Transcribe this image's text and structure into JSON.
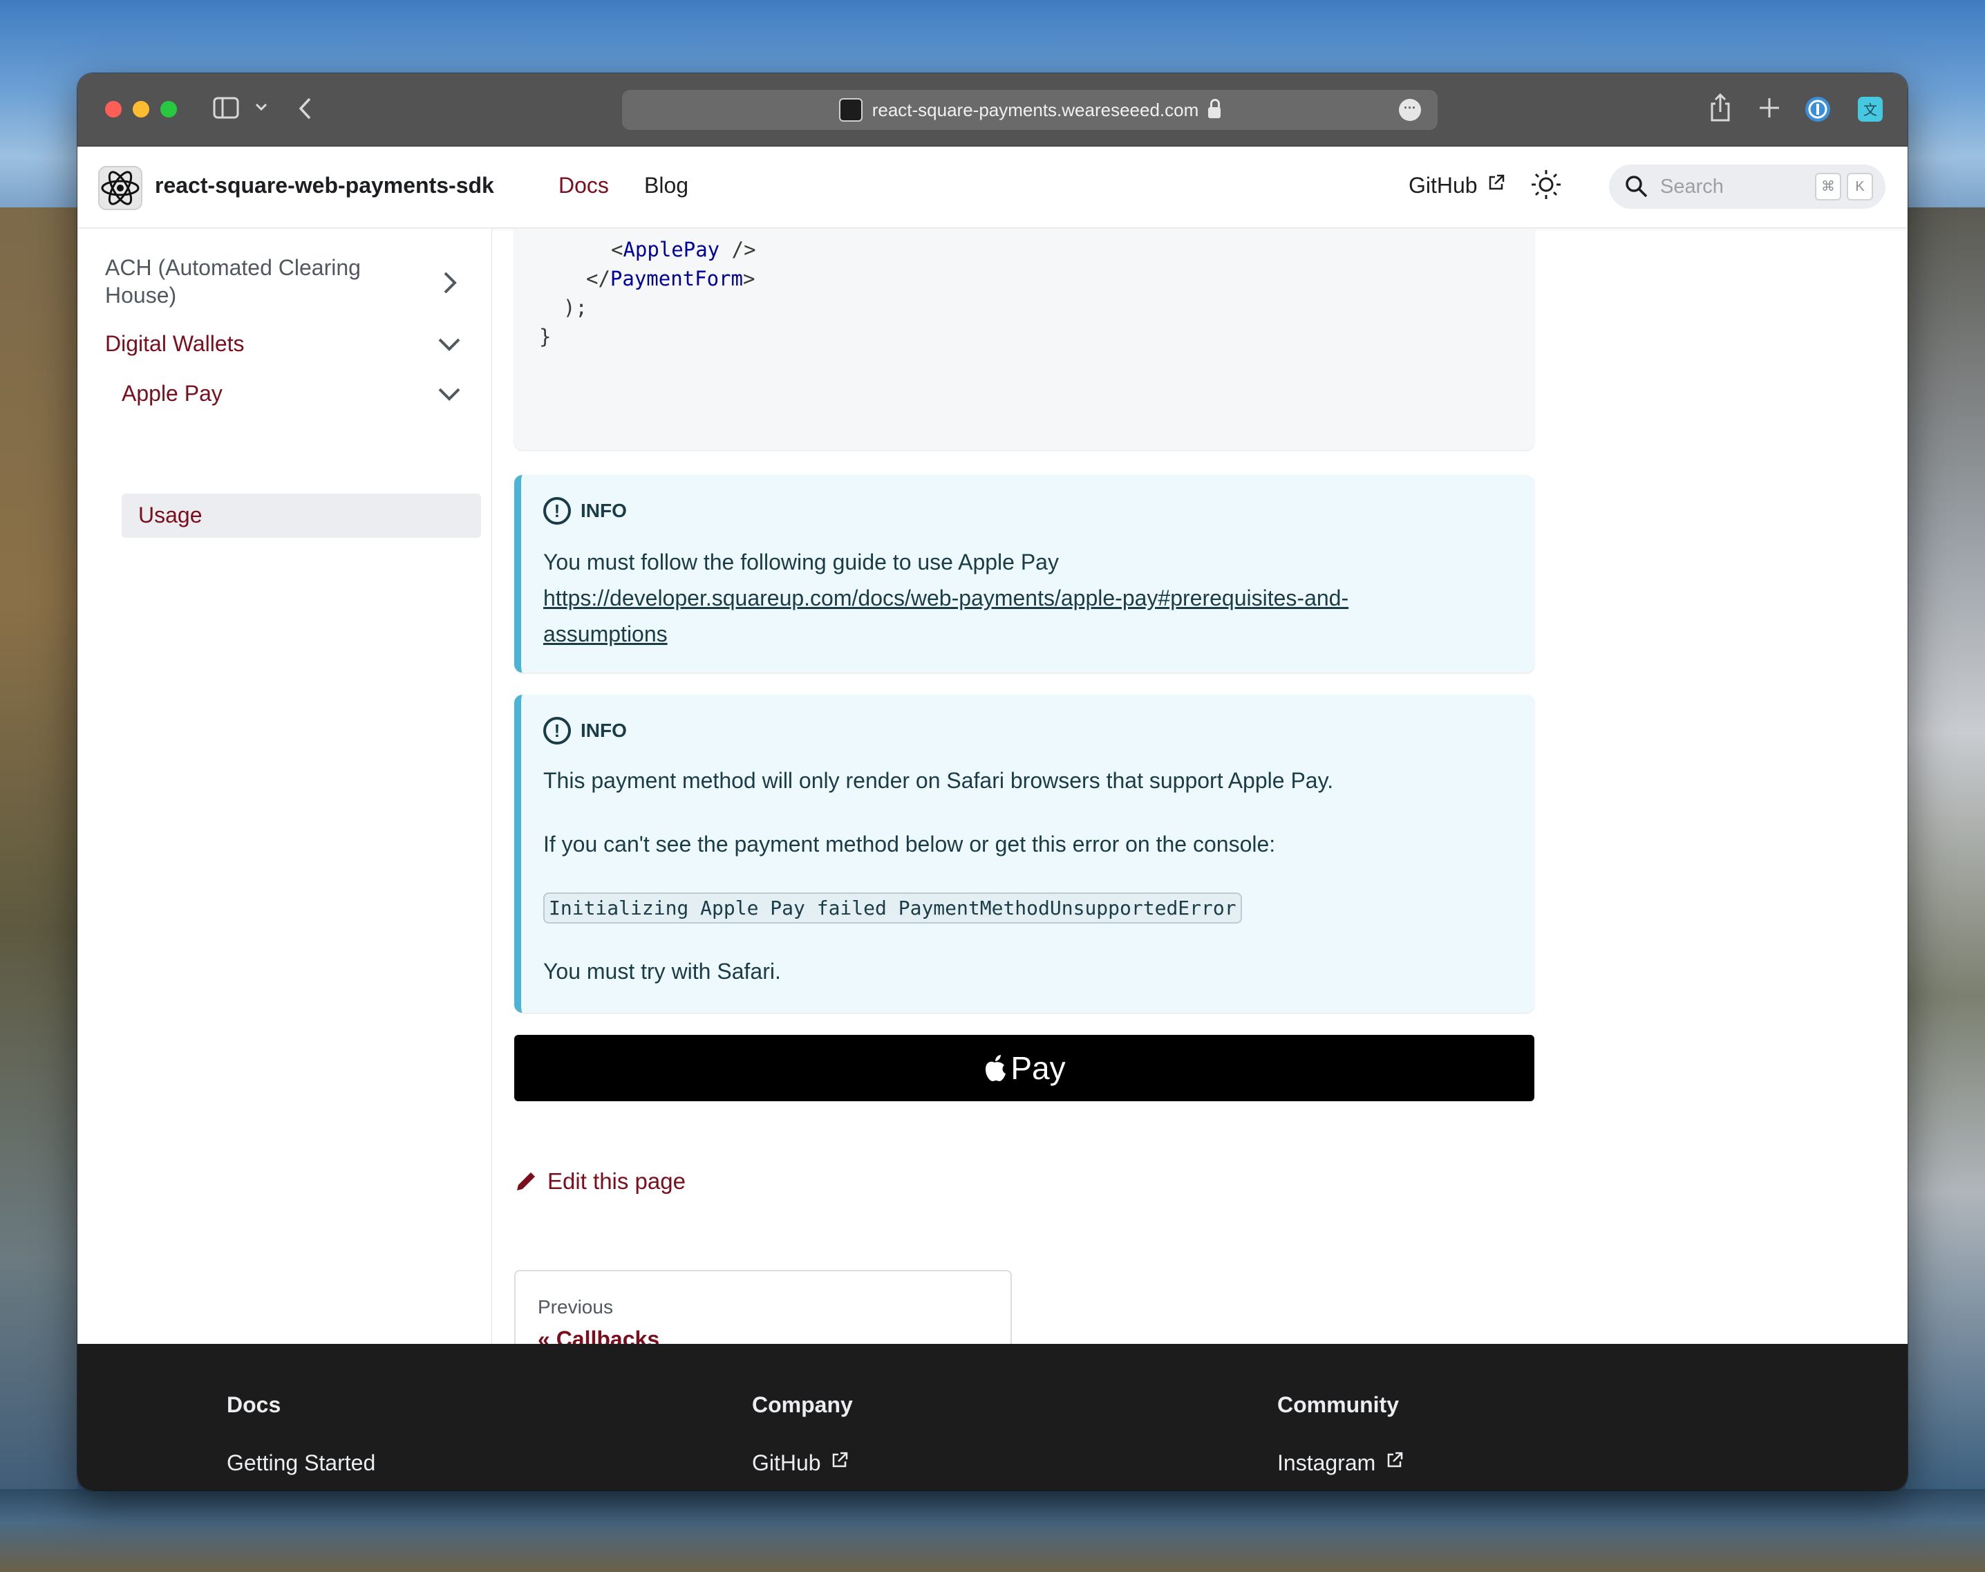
{
  "browser": {
    "url": "react-square-payments.weareseeed.com"
  },
  "navbar": {
    "brand": "react-square-web-payments-sdk",
    "links": [
      "Docs",
      "Blog"
    ],
    "github": "GitHub",
    "search_placeholder": "Search",
    "kbd": [
      "⌘",
      "K"
    ]
  },
  "sidebar": {
    "items": [
      {
        "label_line1": "ACH (Automated Clearing",
        "label_line2": "House)"
      },
      {
        "label": "Digital Wallets"
      },
      {
        "label": "Apple Pay"
      },
      {
        "label": "Usage"
      }
    ]
  },
  "code": {
    "line1_open": "<",
    "line1_tag": "ApplePay",
    "line1_close": " />",
    "line2_open": "</",
    "line2_tag": "PaymentForm",
    "line2_close": ">",
    "line3": "  );",
    "line4": "}"
  },
  "admonitions": [
    {
      "title": "INFO",
      "text": "You must follow the following guide to use Apple Pay",
      "link_line1": "https://developer.squareup.com/docs/web-payments/apple-pay#prerequisites-and-",
      "link_line2": "assumptions"
    },
    {
      "title": "INFO",
      "p1": "This payment method will only render on Safari browsers that support Apple Pay.",
      "p2": "If you can't see the payment method below or get this error on the console:",
      "code": "Initializing Apple Pay failed PaymentMethodUnsupportedError",
      "p3": "You must try with Safari."
    }
  ],
  "apple_pay_button": {
    "label": "Pay"
  },
  "edit_link": "Edit this page",
  "pager": {
    "sub": "Previous",
    "label": "« Callbacks"
  },
  "footer": {
    "columns": [
      {
        "title": "Docs",
        "link": "Getting Started"
      },
      {
        "title": "Company",
        "link": "GitHub"
      },
      {
        "title": "Community",
        "link": "Instagram"
      }
    ]
  },
  "colors": {
    "primary": "#7a0e1c",
    "admonition_border": "#4cb3d4",
    "admonition_bg": "#eef9fd",
    "footer_bg": "#1c1c1c"
  }
}
